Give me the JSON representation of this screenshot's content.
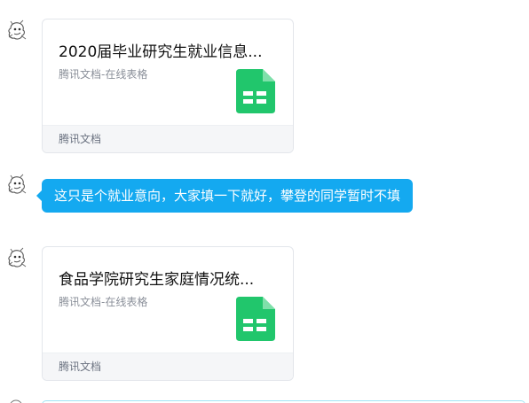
{
  "messages": [
    {
      "type": "doc_card",
      "title": "2020届毕业研究生就业信息...",
      "subtitle": "腾讯文档-在线表格",
      "footer": "腾讯文档",
      "icon": "spreadsheet-icon"
    },
    {
      "type": "text",
      "text": "这只是个就业意向，大家填一下就好，攀登的同学暂时不填"
    },
    {
      "type": "doc_card",
      "title": "食品学院研究生家庭情况统...",
      "subtitle": "腾讯文档-在线表格",
      "footer": "腾讯文档",
      "icon": "spreadsheet-icon"
    }
  ],
  "colors": {
    "bubble_bg": "#14a9f0",
    "sheet_icon": "#21c66c",
    "card_footer_bg": "#f5f6f8"
  }
}
